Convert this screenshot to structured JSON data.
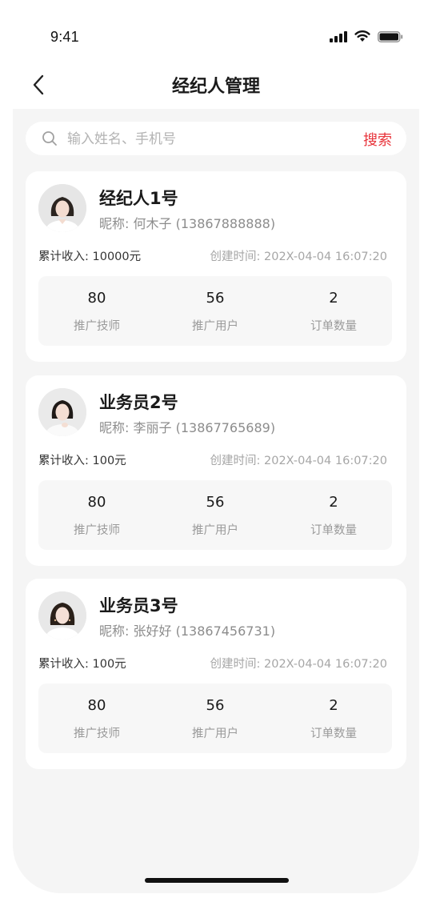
{
  "status_bar": {
    "time": "9:41",
    "icons": [
      "signal-icon",
      "wifi-icon",
      "battery-icon"
    ]
  },
  "header": {
    "title": "经纪人管理",
    "back_icon": "chevron-left-icon"
  },
  "search": {
    "placeholder": "输入姓名、手机号",
    "value": "",
    "button_label": "搜索",
    "icon": "search-icon"
  },
  "colors": {
    "accent": "#e8343b",
    "background": "#f5f5f5",
    "card": "#ffffff",
    "stats_bg": "#f7f7f7"
  },
  "agents": [
    {
      "name": "经纪人1号",
      "nickname_label": "昵称:",
      "nickname": "何木子",
      "phone": "(13867888888)",
      "income_label": "累计收入:",
      "income": "10000元",
      "created_label": "创建时间:",
      "created": "202X-04-04 16:07:20",
      "stats": [
        {
          "value": "80",
          "label": "推广技师"
        },
        {
          "value": "56",
          "label": "推广用户"
        },
        {
          "value": "2",
          "label": "订单数量"
        }
      ]
    },
    {
      "name": "业务员2号",
      "nickname_label": "昵称:",
      "nickname": "李丽子",
      "phone": "(13867765689)",
      "income_label": "累计收入:",
      "income": "100元",
      "created_label": "创建时间:",
      "created": "202X-04-04 16:07:20",
      "stats": [
        {
          "value": "80",
          "label": "推广技师"
        },
        {
          "value": "56",
          "label": "推广用户"
        },
        {
          "value": "2",
          "label": "订单数量"
        }
      ]
    },
    {
      "name": "业务员3号",
      "nickname_label": "昵称:",
      "nickname": "张好好",
      "phone": "(13867456731)",
      "income_label": "累计收入:",
      "income": "100元",
      "created_label": "创建时间:",
      "created": "202X-04-04 16:07:20",
      "stats": [
        {
          "value": "80",
          "label": "推广技师"
        },
        {
          "value": "56",
          "label": "推广用户"
        },
        {
          "value": "2",
          "label": "订单数量"
        }
      ]
    }
  ]
}
